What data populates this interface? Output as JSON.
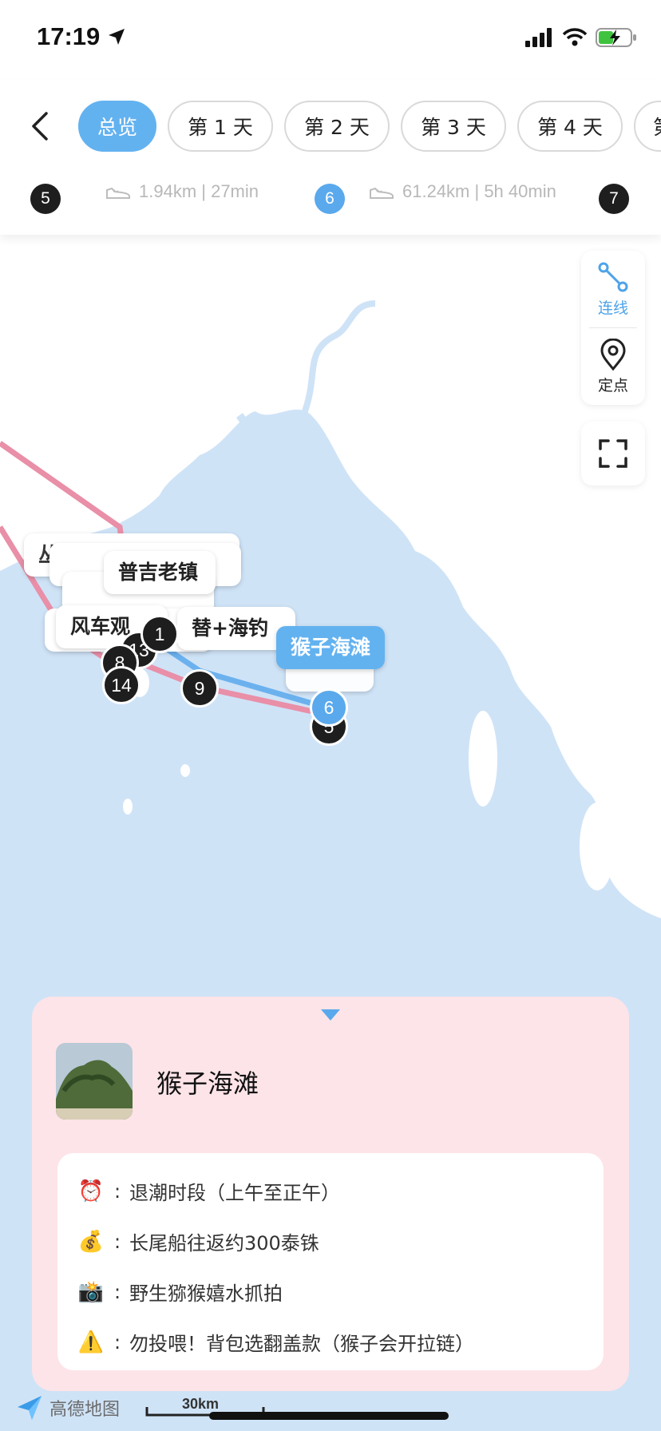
{
  "status": {
    "time": "17:19"
  },
  "tabs": [
    "总览",
    "第 1 天",
    "第 2 天",
    "第 3 天",
    "第 4 天",
    "第"
  ],
  "route": {
    "badge_left": "5",
    "seg1": "1.94km | 27min",
    "badge_mid": "6",
    "seg2": "61.24km | 5h 40min",
    "badge_right": "7"
  },
  "controls": {
    "connect": "连线",
    "locate": "定点"
  },
  "map": {
    "callouts": [
      "普吉老镇",
      "风车观",
      "替+海钓",
      "猴子海滩"
    ],
    "pins": [
      "1",
      "13",
      "14",
      "9",
      "6",
      "5",
      "8"
    ],
    "scale_label": "30km"
  },
  "card": {
    "title": "猴子海滩",
    "info": [
      {
        "icon": "alarm-clock-icon",
        "emoji": "⏰",
        "text": "退潮时段（上午至正午）"
      },
      {
        "icon": "money-bag-icon",
        "emoji": "💰",
        "text": "长尾船往返约300泰铢"
      },
      {
        "icon": "camera-flash-icon",
        "emoji": "📸",
        "text": "野生猕猴嬉水抓拍"
      },
      {
        "icon": "warning-icon",
        "emoji": "⚠️",
        "text": "勿投喂！背包选翻盖款（猴子会开拉链）"
      }
    ]
  },
  "logo": {
    "text": "高德地图"
  },
  "colors": {
    "accent": "#63b2f0",
    "water": "#cfe3f7",
    "land": "#ffffff",
    "card_bg": "#fde4e8",
    "route_pink": "#e98fa8",
    "route_blue": "#6bb1ee"
  }
}
